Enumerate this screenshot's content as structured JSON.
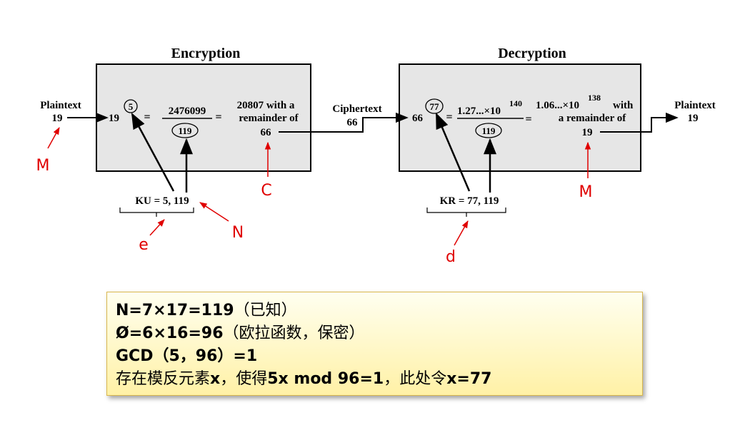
{
  "diagram": {
    "encryption": {
      "title": "Encryption",
      "plaintext_label": "Plaintext",
      "plaintext_value": "19",
      "input_value": "19",
      "exponent_circled": "5",
      "numerator": "2476099",
      "modulus_circled": "119",
      "result_line1": "20807 with a",
      "result_line2": "remainder of",
      "result_line3": "66",
      "key_label": "KU = 5, 119"
    },
    "ciphertext": {
      "label": "Ciphertext",
      "value": "66"
    },
    "decryption": {
      "title": "Decryption",
      "input_value": "66",
      "exponent_circled": "77",
      "numerator_mantissa": "1.27...×10",
      "numerator_exp": "140",
      "modulus_circled": "119",
      "result_mantissa": "1.06...×10",
      "result_exp": "138",
      "result_with": "with",
      "result_line2": "a remainder of",
      "result_line3": "19",
      "key_label": "KR = 77, 119"
    },
    "output": {
      "label": "Plaintext",
      "value": "19"
    },
    "equals": "=",
    "annotations": {
      "m1": "M",
      "c": "C",
      "n": "N",
      "e": "e",
      "m2": "M",
      "d": "d"
    }
  },
  "note": {
    "line1_bold": "N=7×17=119",
    "line1_rest": "（已知）",
    "line2_bold": "Ø=6×16=96",
    "line2_rest": "（欧拉函数，保密）",
    "line3": "GCD（5，96）=1",
    "line4_a": "存在模反元素",
    "line4_b": "x",
    "line4_c": "，使得",
    "line4_d": "5x mod 96=1",
    "line4_e": "，此处令",
    "line4_f": "x=77"
  },
  "colors": {
    "box_fill": "#e6e6e6",
    "annotation": "#e00000",
    "note_border": "#d9b74d"
  }
}
